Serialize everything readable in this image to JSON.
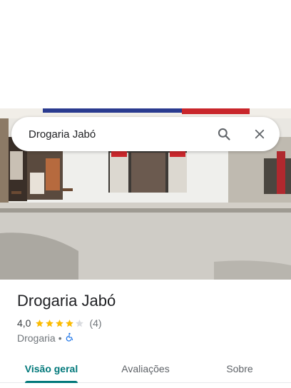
{
  "search": {
    "value": "Drogaria Jabó"
  },
  "place": {
    "name": "Drogaria Jabó",
    "rating": "4,0",
    "rating_stars": 4,
    "review_count": "(4)",
    "category": "Drogaria",
    "separator": "•"
  },
  "tabs": [
    {
      "label": "Visão geral",
      "active": true
    },
    {
      "label": "Avaliações",
      "active": false
    },
    {
      "label": "Sobre",
      "active": false
    }
  ],
  "colors": {
    "accent": "#01787a",
    "star": "#fbbc04",
    "star_empty": "#dadce0",
    "accessibility_icon": "#1a73e8"
  },
  "icons": [
    "search-icon",
    "close-icon",
    "star-icon",
    "wheelchair-icon"
  ]
}
